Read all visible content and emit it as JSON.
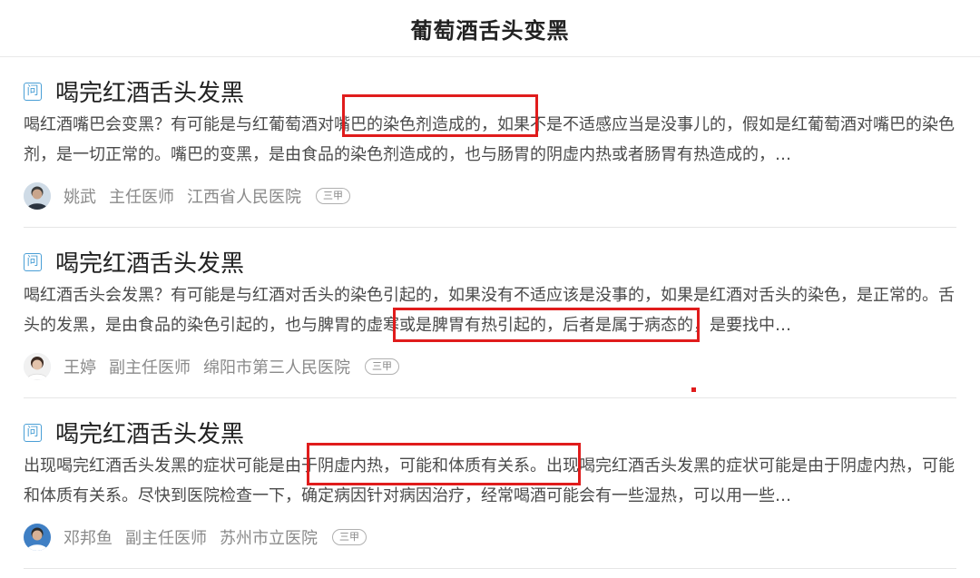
{
  "page": {
    "title": "葡萄酒舌头变黑"
  },
  "cards": [
    {
      "icon": "question-icon",
      "icon_glyph": "问",
      "title": "喝完红酒舌头发黑",
      "summary": "喝红酒嘴巴会变黑？有可能是与红葡萄酒对嘴巴的染色剂造成的，如果不是不适感应当是没事儿的，假如是红葡萄酒对嘴巴的染色剂，是一切正常的。嘴巴的变黑，是由食品的染色剂造成的，也与肠胃的阴虚内热或者肠胃有热造成的，…",
      "doctor_name": "姚武",
      "doctor_title": "主任医师",
      "hospital": "江西省人民医院",
      "grade": "三甲"
    },
    {
      "icon": "question-icon",
      "icon_glyph": "问",
      "title": "喝完红酒舌头发黑",
      "summary": "喝红酒舌头会发黑？有可能是与红酒对舌头的染色引起的，如果没有不适应该是没事的，如果是红酒对舌头的染色，是正常的。舌头的发黑，是由食品的染色引起的，也与脾胃的虚寒或是脾胃有热引起的，后者是属于病态的，是要找中…",
      "doctor_name": "王婷",
      "doctor_title": "副主任医师",
      "hospital": "绵阳市第三人民医院",
      "grade": "三甲"
    },
    {
      "icon": "question-icon",
      "icon_glyph": "问",
      "title": "喝完红酒舌头发黑",
      "summary": "出现喝完红酒舌头发黑的症状可能是由于阴虚内热，可能和体质有关系。出现喝完红酒舌头发黑的症状可能是由于阴虚内热，可能和体质有关系。尽快到医院检查一下，确定病因针对病因治疗，经常喝酒可能会有一些湿热，可以用一些…",
      "doctor_name": "邓邦鱼",
      "doctor_title": "副主任医师",
      "hospital": "苏州市立医院",
      "grade": "三甲"
    }
  ],
  "colors": {
    "highlight": "#e01c1c",
    "icon_accent": "#4a9fd6"
  }
}
